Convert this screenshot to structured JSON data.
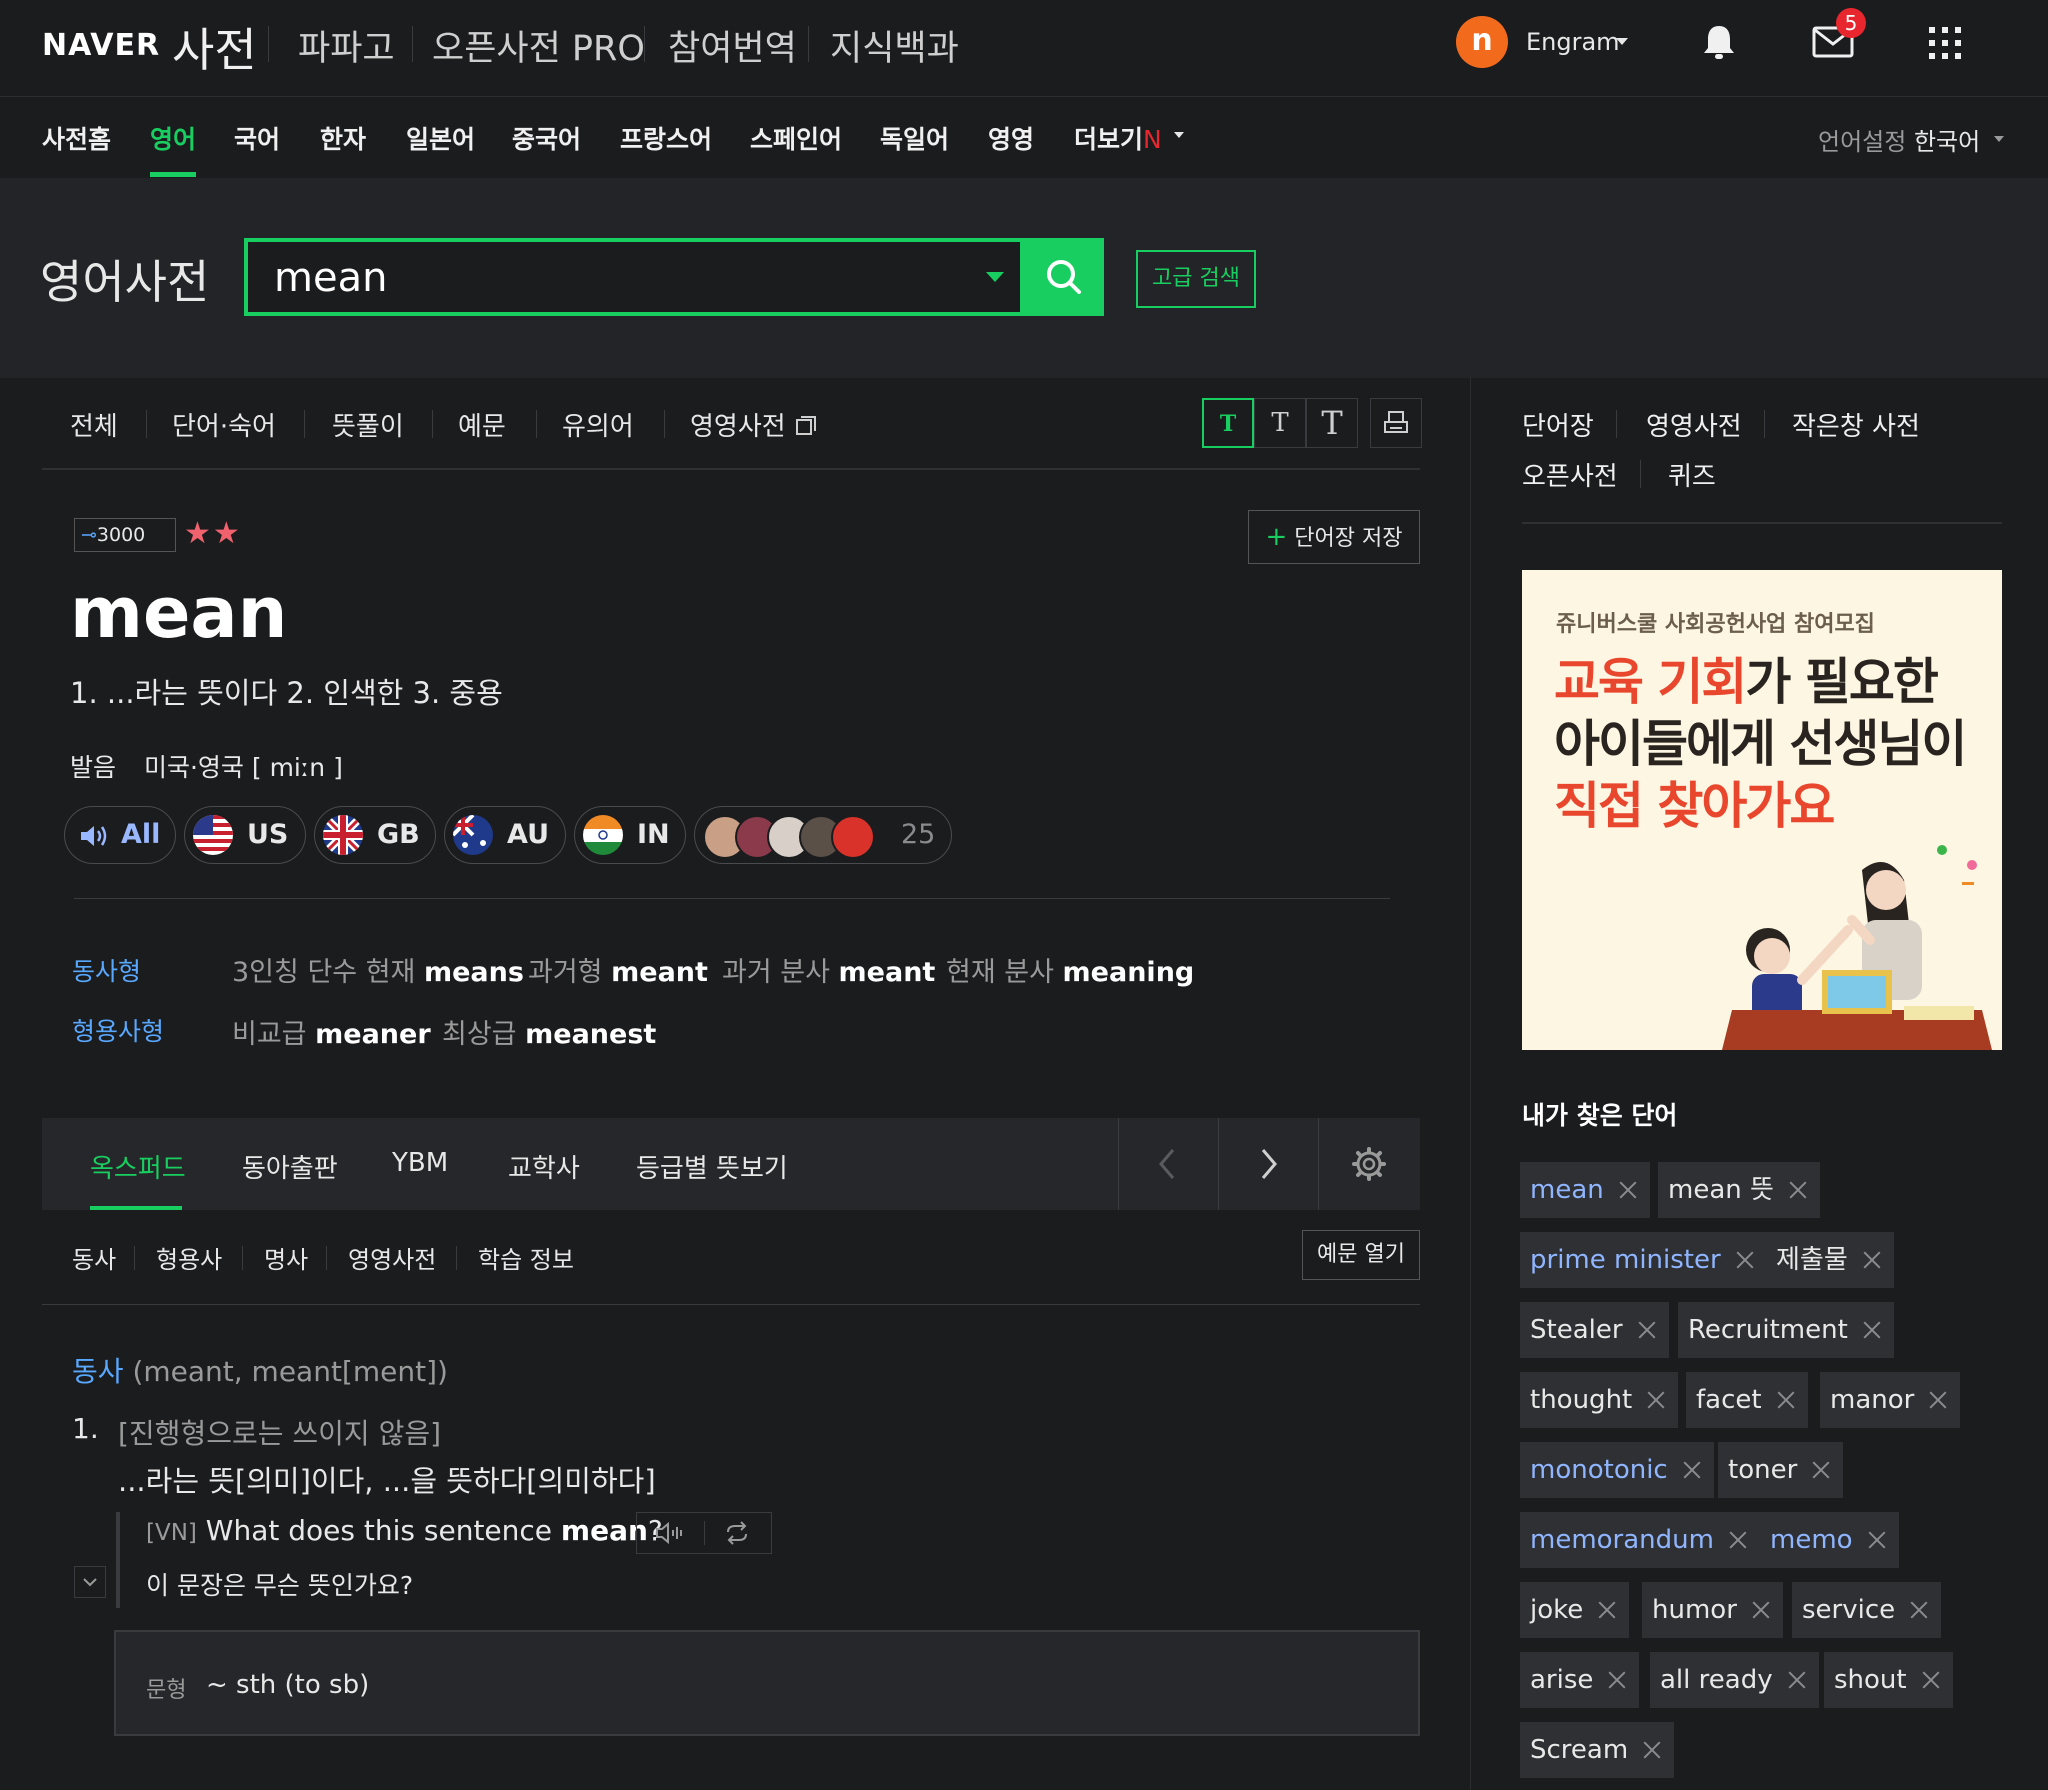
{
  "topbar": {
    "logo": "NAVER",
    "title": "사전",
    "links": [
      "파파고",
      "오픈사전 PRO",
      "참여번역",
      "지식백과"
    ],
    "user_avatar": "n",
    "user_name": "Engram",
    "mail_count": "5",
    "icons": [
      "bell-icon",
      "mail-icon",
      "apps-grid-icon"
    ]
  },
  "category_nav": {
    "items": [
      "사전홈",
      "영어",
      "국어",
      "한자",
      "일본어",
      "중국어",
      "프랑스어",
      "스페인어",
      "독일어",
      "영영",
      "더보기"
    ],
    "active": "영어",
    "more_badge": "N",
    "lang_setting_label": "언어설정",
    "lang_setting_value": "한국어"
  },
  "search": {
    "label": "영어사전",
    "value": "mean",
    "advanced_label": "고급 검색",
    "accent_color": "#19ce60"
  },
  "result_tabs": {
    "items": [
      "전체",
      "단어·숙어",
      "뜻풀이",
      "예문",
      "유의어",
      "영영사전"
    ],
    "font_buttons": [
      "T",
      "T",
      "T"
    ]
  },
  "entry": {
    "level": "3000",
    "stars": "★★",
    "save_label": "단어장 저장",
    "headword": "mean",
    "summary": "1. ...라는 뜻이다 2. 인색한 3. 중용",
    "pron_label": "발음",
    "pron_region": "미국·영국",
    "pron_ipa": "[ miːn ]",
    "audio": [
      {
        "label": "All"
      },
      {
        "label": "US"
      },
      {
        "label": "GB"
      },
      {
        "label": "AU"
      },
      {
        "label": "IN"
      },
      {
        "label": "25"
      }
    ],
    "verb_forms_label": "동사형",
    "verb_forms": [
      {
        "k": "3인칭 단수 현재",
        "v": "means"
      },
      {
        "k": "과거형",
        "v": "meant"
      },
      {
        "k": "과거 분사",
        "v": "meant"
      },
      {
        "k": "현재 분사",
        "v": "meaning"
      }
    ],
    "adj_forms_label": "형용사형",
    "adj_forms": [
      {
        "k": "비교급",
        "v": "meaner"
      },
      {
        "k": "최상급",
        "v": "meanest"
      }
    ]
  },
  "sources": {
    "items": [
      "옥스퍼드",
      "동아출판",
      "YBM",
      "교학사",
      "등급별 뜻보기"
    ],
    "active": "옥스퍼드"
  },
  "pos_tabs": {
    "items": [
      "동사",
      "형용사",
      "명사",
      "영영사전",
      "학습 정보"
    ],
    "examples_open": "예문 열기"
  },
  "sense": {
    "pos": "동사",
    "forms": "(meant, meant[ment])",
    "num": "1.",
    "note": "[진행형으로는 쓰이지 않음]",
    "definition": "...라는 뜻[의미]이다, ...을 뜻하다[의미하다]",
    "example_tag": "[VN]",
    "example_pre": "What does this sentence ",
    "example_bold": "mean",
    "example_post": "?",
    "example_ko": "이 문장은 무슨 뜻인가요?",
    "pattern_label": "문형",
    "pattern": "~ sth (to sb)"
  },
  "sidebar": {
    "links_row1": [
      "단어장",
      "영영사전",
      "작은창 사전"
    ],
    "links_row2": [
      "오픈사전",
      "퀴즈"
    ],
    "ad": {
      "subtitle": "쥬니버스쿨 사회공헌사업 참여모집",
      "line1_a": "교육 기회",
      "line1_b": "가 필요한",
      "line2": "아이들에게 선생님이",
      "line3": "직접 찾아가요"
    },
    "recent_title": "내가 찾은 단어",
    "recent": [
      {
        "word": "mean",
        "blue": true
      },
      {
        "word": "mean 뜻",
        "blue": false
      },
      {
        "word": "prime minister",
        "blue": true
      },
      {
        "word": "제출물",
        "blue": false
      },
      {
        "word": "Stealer",
        "blue": false
      },
      {
        "word": "Recruitment",
        "blue": false
      },
      {
        "word": "thought",
        "blue": false
      },
      {
        "word": "facet",
        "blue": false
      },
      {
        "word": "manor",
        "blue": false
      },
      {
        "word": "monotonic",
        "blue": true
      },
      {
        "word": "toner",
        "blue": false
      },
      {
        "word": "memorandum",
        "blue": true
      },
      {
        "word": "memo",
        "blue": true
      },
      {
        "word": "joke",
        "blue": false
      },
      {
        "word": "humor",
        "blue": false
      },
      {
        "word": "service",
        "blue": false
      },
      {
        "word": "arise",
        "blue": false
      },
      {
        "word": "all ready",
        "blue": false
      },
      {
        "word": "shout",
        "blue": false
      },
      {
        "word": "Scream",
        "blue": false
      }
    ]
  }
}
